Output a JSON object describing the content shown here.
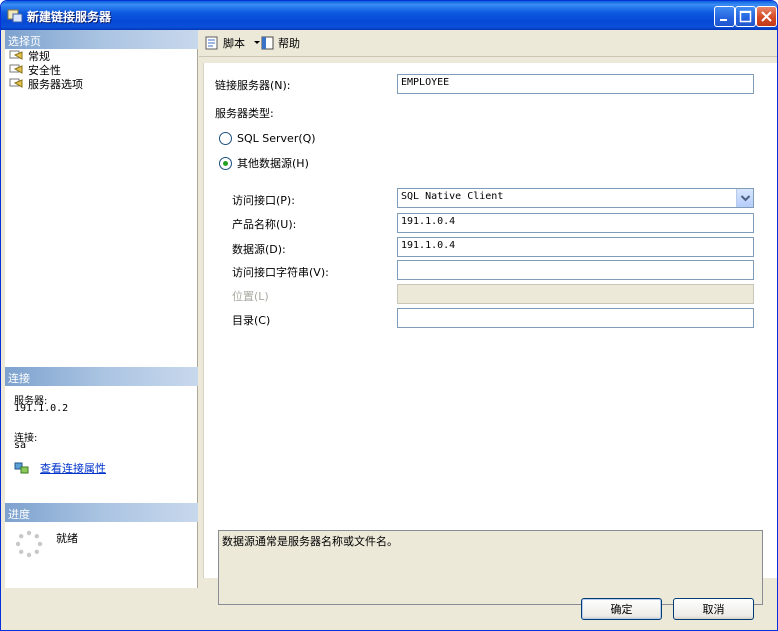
{
  "window": {
    "title": "新建链接服务器"
  },
  "left": {
    "select_page_header": "选择页",
    "pages": [
      {
        "label": "常规"
      },
      {
        "label": "安全性"
      },
      {
        "label": "服务器选项"
      }
    ],
    "connection_header": "连接",
    "server_label": "服务器:",
    "server_value": "191.1.0.2",
    "connection_label": "连接:",
    "connection_value": "sa",
    "view_props_link": "查看连接属性",
    "progress_header": "进度",
    "progress_status": "就绪"
  },
  "toolbar": {
    "script_label": "脚本",
    "help_label": "帮助"
  },
  "form": {
    "linked_server_label": "链接服务器(N):",
    "linked_server_value": "EMPLOYEE",
    "server_type_label": "服务器类型:",
    "radio_sql_server": "SQL Server(Q)",
    "radio_other": "其他数据源(H)",
    "selected_server_type": "其他数据源(H)",
    "provider_label": "访问接口(P):",
    "provider_value": "SQL Native Client",
    "product_label": "产品名称(U):",
    "product_value": "191.1.0.4",
    "datasource_label": "数据源(D):",
    "datasource_value": "191.1.0.4",
    "provider_string_label": "访问接口字符串(V):",
    "provider_string_value": "",
    "location_label": "位置(L)",
    "location_value": "",
    "catalog_label": "目录(C)",
    "catalog_value": ""
  },
  "description": "数据源通常是服务器名称或文件名。",
  "buttons": {
    "ok": "确定",
    "cancel": "取消"
  },
  "colors": {
    "titlebar": "#0a50d8",
    "section_header": "#7da2ce",
    "link": "#0033cc"
  }
}
